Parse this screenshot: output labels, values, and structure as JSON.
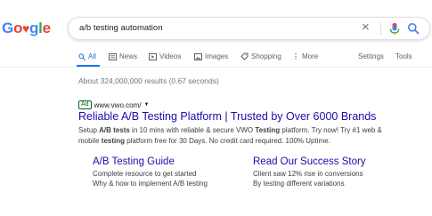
{
  "logo": {
    "text": "Google"
  },
  "search": {
    "query": "a/b testing automation"
  },
  "tabs": [
    {
      "label": "All",
      "icon": "search-icon",
      "active": true
    },
    {
      "label": "News",
      "icon": "news-icon"
    },
    {
      "label": "Videos",
      "icon": "video-icon"
    },
    {
      "label": "Images",
      "icon": "image-icon"
    },
    {
      "label": "Shopping",
      "icon": "tag-icon"
    },
    {
      "label": "More",
      "icon": "more-vertical-icon"
    }
  ],
  "tools": {
    "settings": "Settings",
    "tools": "Tools"
  },
  "stats": "About 324,000,000 results (0.67 seconds)",
  "ad": {
    "badge": "Ad",
    "url": "www.vwo.com/",
    "title": "Reliable A/B Testing Platform | Trusted by Over 6000 Brands",
    "description": [
      {
        "text": "Setup ",
        "bold": false
      },
      {
        "text": "A/B tests",
        "bold": true
      },
      {
        "text": " in 10 mins with reliable & secure VWO ",
        "bold": false
      },
      {
        "text": "Testing",
        "bold": true
      },
      {
        "text": " platform. Try now! Try #1 web & mobile ",
        "bold": false
      },
      {
        "text": "testing",
        "bold": true
      },
      {
        "text": " platform free for 30 Days. No credit card required. 100% Uptime.",
        "bold": false
      }
    ]
  },
  "sitelinks": [
    {
      "title": "A/B Testing Guide",
      "lines": [
        "Complete resource to get started",
        "Why & how to implement A/B testing"
      ]
    },
    {
      "title": "Read Our Success Story",
      "lines": [
        "Client saw 12% rise in conversions",
        "By testing different variations"
      ]
    }
  ],
  "colors": {
    "link": "#1a0dab",
    "accent": "#1a73e8",
    "ad_green": "#006621"
  }
}
